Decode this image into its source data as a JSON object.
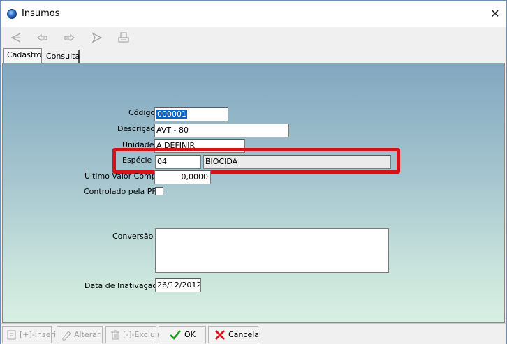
{
  "window": {
    "title": "Insumos",
    "close_glyph": "✕"
  },
  "toolbar": {
    "buttons": [
      {
        "icon": "first-record-icon"
      },
      {
        "icon": "previous-record-icon"
      },
      {
        "icon": "next-record-icon"
      },
      {
        "icon": "last-record-icon"
      },
      {
        "icon": "print-icon"
      }
    ]
  },
  "tabs": [
    {
      "label": "Cadastro",
      "active": true
    },
    {
      "label": "Consulta",
      "active": false
    }
  ],
  "form": {
    "codigo": {
      "label": "Código",
      "value": "000001"
    },
    "descricao": {
      "label": "Descrição",
      "value": "AVT - 80"
    },
    "unidade": {
      "label": "Unidade",
      "value": "A DEFINIR"
    },
    "especie": {
      "label": "Espécie",
      "code": "04",
      "name": "BIOCIDA"
    },
    "ultimo_valor": {
      "label": "Último Valor Compra",
      "value": "0,0000"
    },
    "controlado": {
      "label": "Controlado pela PF",
      "checked": false
    },
    "conversao": {
      "label": "Conversão",
      "value": ""
    },
    "data_inativacao": {
      "label": "Data de Inativação",
      "value": "26/12/2012"
    }
  },
  "highlight_color": "#d4121b",
  "actions": {
    "inserir": "[+]-Inserir",
    "alterar": "Alterar",
    "excluir": "[-]-Excluir",
    "ok": "OK",
    "cancela": "Cancela"
  }
}
